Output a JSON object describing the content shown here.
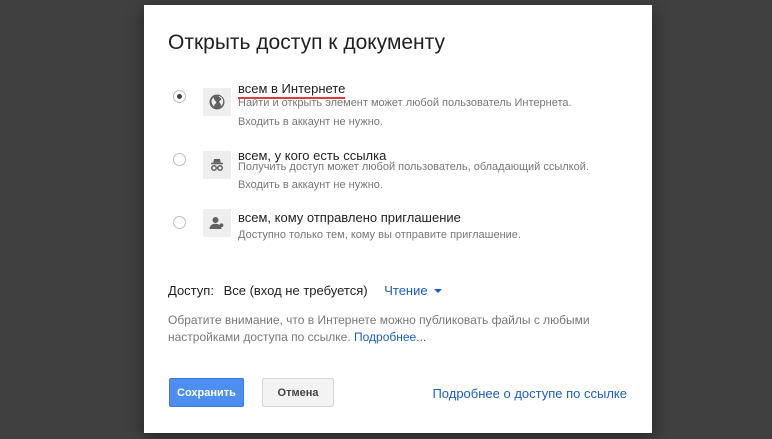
{
  "dialog": {
    "title": "Открыть доступ к документу",
    "options": [
      {
        "label": "всем в Интернете",
        "desc_line1": "Найти и открыть элемент может любой пользователь Интернета.",
        "desc_line2": "Входить в аккаунт не нужно.",
        "icon": "globe-icon",
        "selected": true
      },
      {
        "label": "всем, у кого есть ссылка",
        "desc_line1": "Получить доступ может любой пользователь, обладающий ссылкой.",
        "desc_line2": "Входить в аккаунт не нужно.",
        "icon": "incognito-person-icon",
        "selected": false
      },
      {
        "label": "всем, кому отправлено приглашение",
        "desc_line1": "Доступно только тем, кому вы отправите приглашение.",
        "icon": "person-icon",
        "selected": false
      }
    ],
    "access": {
      "label": "Доступ:",
      "value": "Все (вход не требуется)",
      "mode": "Чтение"
    },
    "note": {
      "text": "Обратите внимание, что в Интернете можно публиковать файлы с любыми настройками доступа по ссылке. ",
      "link": "Подробнее..."
    },
    "buttons": {
      "save": "Сохранить",
      "cancel": "Отмена"
    },
    "more_link": "Подробнее о доступе по ссылке"
  },
  "colors": {
    "overlay": "#404040",
    "primary_button": "#4d8ff0",
    "link": "#1a5fbf",
    "highlight_underline": "#dd3c3c"
  }
}
